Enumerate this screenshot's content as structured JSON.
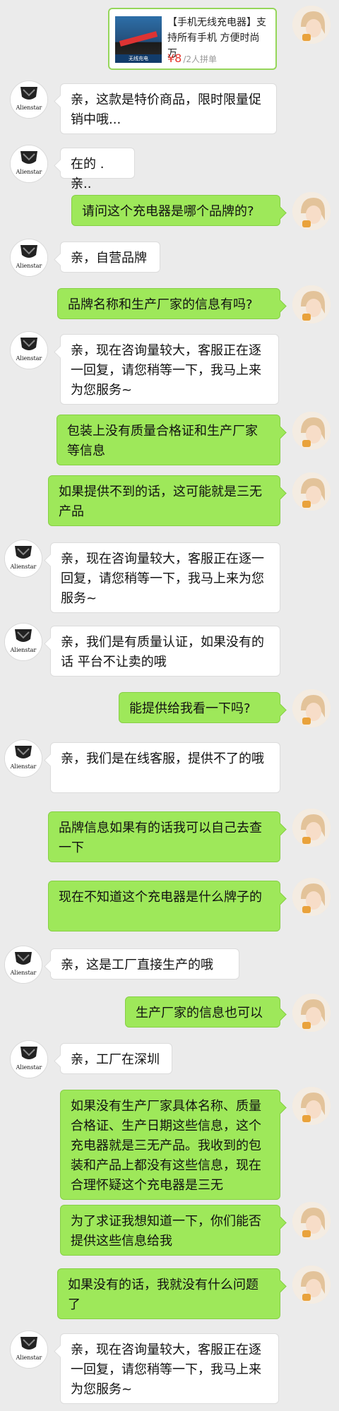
{
  "product": {
    "title": "【手机无线充电器】支持所有手机 方便时尚 万",
    "price": "¥8",
    "group": "/2人拼单",
    "thumb_caption": "无线充电"
  },
  "shop_avatar_text": "Alienstar",
  "messages": [
    {
      "side": "left",
      "text": "亲，这款是特价商品，限时限量促销中哦..."
    },
    {
      "side": "left",
      "text": "在的 .亲.."
    },
    {
      "side": "right",
      "text": "请问这个充电器是哪个品牌的?"
    },
    {
      "side": "left",
      "text": "亲，自营品牌"
    },
    {
      "side": "right",
      "text": "品牌名称和生产厂家的信息有吗?"
    },
    {
      "side": "left",
      "text": "亲，现在咨询量较大，客服正在逐一回复，请您稍等一下，我马上来为您服务~"
    },
    {
      "side": "right",
      "text": "包装上没有质量合格证和生产厂家等信息"
    },
    {
      "side": "right",
      "text": "如果提供不到的话，这可能就是三无产品"
    },
    {
      "side": "left",
      "text": "亲，现在咨询量较大，客服正在逐一回复，请您稍等一下，我马上来为您服务~"
    },
    {
      "side": "left",
      "text": "亲，我们是有质量认证，如果没有的话 平台不让卖的哦"
    },
    {
      "side": "right",
      "text": "能提供给我看一下吗?"
    },
    {
      "side": "left",
      "text": "亲，我们是在线客服，提供不了的哦"
    },
    {
      "side": "right",
      "text": "品牌信息如果有的话我可以自己去查一下"
    },
    {
      "side": "right",
      "text": "现在不知道这个充电器是什么牌子的"
    },
    {
      "side": "left",
      "text": "亲，这是工厂直接生产的哦"
    },
    {
      "side": "right",
      "text": "生产厂家的信息也可以"
    },
    {
      "side": "left",
      "text": "亲，工厂在深圳"
    },
    {
      "side": "right",
      "text": "如果没有生产厂家具体名称、质量合格证、生产日期这些信息，这个充电器就是三无产品。我收到的包装和产品上都没有这些信息，现在合理怀疑这个充电器是三无"
    },
    {
      "side": "right",
      "text": "为了求证我想知道一下，你们能否提供这些信息给我"
    },
    {
      "side": "right",
      "text": "如果没有的话，我就没有什么问题了"
    },
    {
      "side": "left",
      "text": "亲，现在咨询量较大，客服正在逐一回复，请您稍等一下，我马上来为您服务~"
    }
  ]
}
